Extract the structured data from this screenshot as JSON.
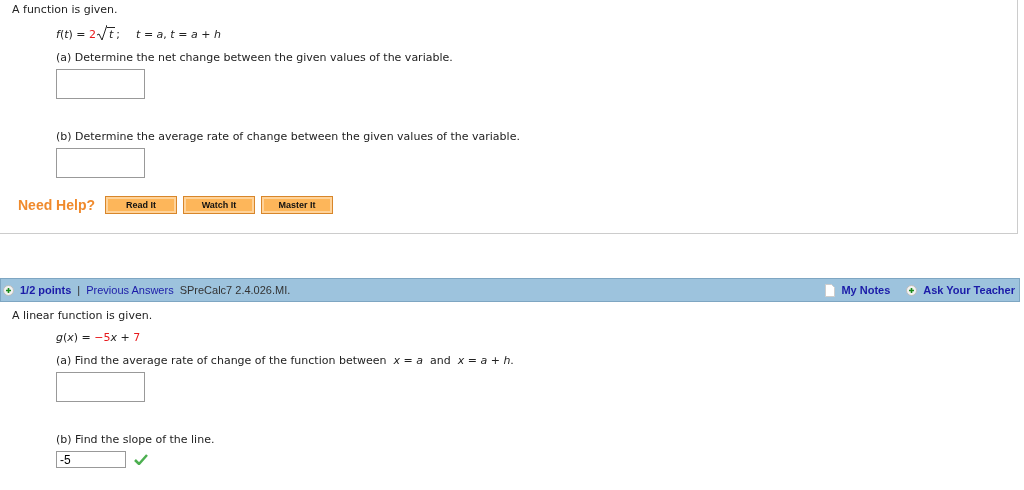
{
  "question_1": {
    "intro": "A function is given.",
    "formula": [
      {
        "kind": "plain",
        "text": "*f*(*t*) = "
      },
      {
        "kind": "given",
        "text": "2"
      },
      {
        "kind": "sqrt",
        "text": "*t*"
      },
      {
        "kind": "plain",
        "text": ";"
      },
      {
        "kind": "gap",
        "text": "*t* = *a*, *t* = *a* + *h*"
      }
    ],
    "parts": [
      {
        "prompt": "(a) Determine the net change between the given values of the variable."
      },
      {
        "prompt": "(b) Determine the average rate of change between the given values of the variable."
      }
    ],
    "help": {
      "label": "Need Help?",
      "buttons": [
        "Read It",
        "Watch It",
        "Master It"
      ]
    }
  },
  "question_2": {
    "header": {
      "points": "1/2 points",
      "separator": "|",
      "previous_answers": "Previous Answers",
      "source": "SPreCalc7 2.4.026.MI.",
      "my_notes": "My Notes",
      "ask_teacher": "Ask Your Teacher"
    },
    "intro": "A linear function is given.",
    "formula": [
      {
        "kind": "plain",
        "text": "*g*(*x*) = "
      },
      {
        "kind": "given",
        "text": "−5"
      },
      {
        "kind": "plain",
        "text": "*x* + "
      },
      {
        "kind": "given",
        "text": "7"
      }
    ],
    "parts": [
      {
        "prompt": "(a) Find the average rate of change of the function between  *x* = *a*  and  *x* = *a* + *h*."
      },
      {
        "prompt": "(b) Find the slope of the line.",
        "answer": {
          "value": "-5",
          "correct": true
        }
      }
    ]
  }
}
